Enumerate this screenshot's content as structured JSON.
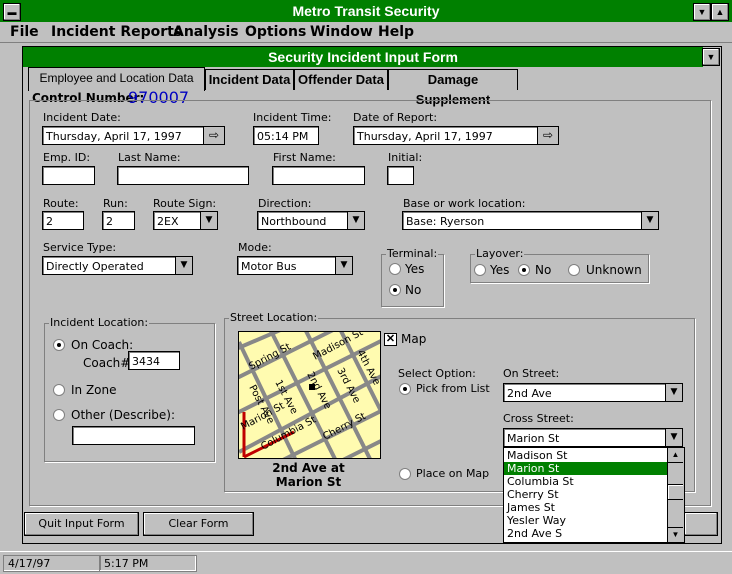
{
  "window": {
    "title": "Metro Transit Security"
  },
  "menu": [
    "File",
    "Incident Reports",
    "Analysis",
    "Options",
    "Window",
    "Help"
  ],
  "form": {
    "title": "Security Incident Input Form"
  },
  "tabs": [
    "Employee and Location Data",
    "Incident Data",
    "Offender Data",
    "Damage Supplement"
  ],
  "control": {
    "label": "Control Number:",
    "value": "970007"
  },
  "fields": {
    "incident_date_label": "Incident Date:",
    "incident_date": "Thursday, April 17, 1997",
    "incident_time_label": "Incident Time:",
    "incident_time": "05:14 PM",
    "report_date_label": "Date of Report:",
    "report_date": "Thursday, April 17, 1997",
    "emp_id_label": "Emp. ID:",
    "emp_id": "",
    "last_name_label": "Last Name:",
    "last_name": "",
    "first_name_label": "First Name:",
    "first_name": "",
    "initial_label": "Initial:",
    "initial": "",
    "route_label": "Route:",
    "route": "2",
    "run_label": "Run:",
    "run": "2",
    "route_sign_label": "Route Sign:",
    "route_sign": "2EX",
    "direction_label": "Direction:",
    "direction": "Northbound",
    "base_label": "Base or work location:",
    "base": "Base: Ryerson",
    "service_label": "Service Type:",
    "service": "Directly Operated",
    "mode_label": "Mode:",
    "mode": "Motor Bus"
  },
  "terminal": {
    "label": "Terminal:",
    "yes": "Yes",
    "no": "No",
    "selected": "No"
  },
  "layover": {
    "label": "Layover:",
    "yes": "Yes",
    "no": "No",
    "unknown": "Unknown",
    "selected": "No"
  },
  "incident_location": {
    "label": "Incident Location:",
    "on_coach": "On Coach:",
    "coach_label": "Coach#:",
    "coach": "3434",
    "in_zone": "In Zone",
    "other": "Other (Describe):",
    "other_value": "",
    "selected": "On Coach"
  },
  "street": {
    "label": "Street Location:",
    "map_label": "Map",
    "map_checked": true,
    "select_option": "Select Option:",
    "pick": "Pick from List",
    "place": "Place on Map",
    "on_street_label": "On Street:",
    "on_street": "2nd Ave",
    "cross_label": "Cross Street:",
    "cross_street": "Marion St",
    "caption_line1": "2nd Ave at",
    "caption_line2": "Marion St",
    "map_streets": [
      "Spring St",
      "Madison St",
      "4th Ave",
      "Post Ave",
      "1st Ave",
      "2nd Ave",
      "3rd Ave",
      "Marion St",
      "Columbia St",
      "Cherry St"
    ],
    "options": [
      "Madison St",
      "Marion St",
      "Columbia St",
      "Cherry St",
      "James St",
      "Yesler Way",
      "2nd Ave S"
    ],
    "selected_option": "Marion St"
  },
  "buttons": {
    "quit": "Quit Input Form",
    "clear": "Clear Form"
  },
  "status": {
    "date": "4/17/97",
    "time": "5:17 PM"
  },
  "colors": {
    "accent": "#008000",
    "control_number": "#0000c0"
  }
}
